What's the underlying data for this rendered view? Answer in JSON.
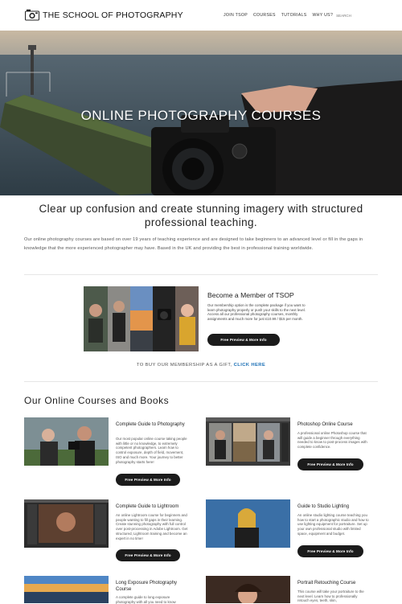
{
  "header": {
    "logo_text": "THE SCHOOL OF PHOTOGRAPHY",
    "nav": [
      "JOIN TSOP",
      "COURSES",
      "TUTORIALS",
      "WHY US?"
    ],
    "search_placeholder": "SEARCH"
  },
  "hero": {
    "title": "ONLINE PHOTOGRAPHY COURSES"
  },
  "intro": {
    "heading": "Clear up confusion and create stunning imagery with structured professional teaching.",
    "paragraph": "Our online photography courses are based on over 19 years of teaching experience and are designed to take beginners to an advanced level or fill in the gaps in knowledge that the more experienced photographer may have. Based in the UK and providing the best in professional training worldwide."
  },
  "membership": {
    "title": "Become a Member of TSOP",
    "description": "Our membership option is the complete package if you want to learn photography properly or push your skills to the next level. Access all our professional photography courses, monthly assignments and much more for just £10.99 / $15 per month.",
    "button": "Free Preview & More Info"
  },
  "gift": {
    "text": "TO BUY OUR MEMBERSHIP AS A GIFT, ",
    "link": "CLICK HERE"
  },
  "courses_heading": "Our Online Courses and Books",
  "courses": [
    {
      "title": "Complete Guide to Photography",
      "description": "Our most popular online course taking people with little or no knowledge, to extremely competent photographers. Learn how to control exposure, depth of field, movement, ISO and much more. Your journey to better photography starts here!",
      "button": "Free Preview & More Info"
    },
    {
      "title": "Photoshop Online Course",
      "description": "A professional online Photoshop course that will guide a beginner through everything needed to know to post-process images with complete confidence.",
      "button": "Free Preview & More Info"
    },
    {
      "title": "Complete Guide to Lightroom",
      "description": "An online Lightroom course for beginners and people wanting to fill gaps in their learning. Create stunning photography with full control over post-processing in Adobe Lightroom. Get structured, Lightroom training and become an expert in no time!",
      "button": "Free Preview & More Info"
    },
    {
      "title": "Guide to Studio Lighting",
      "description": "An online studio lighting course teaching you how to start a photographic studio and how to use lighting equipment for portraiture. Set up your own professional studio with limited space, equipment and budget.",
      "button": "Free Preview & More Info"
    },
    {
      "title": "Long Exposure Photography Course",
      "description": "A complete guide to long exposure photography with all you need to know",
      "button": ""
    },
    {
      "title": "Portrait Retouching Course",
      "description": "This course will take your portraiture to the next level. Learn how to professionally retouch eyes, teeth, skin,",
      "button": ""
    }
  ]
}
